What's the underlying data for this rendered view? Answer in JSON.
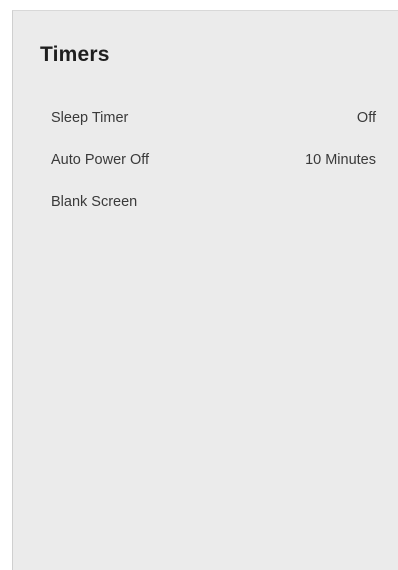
{
  "menu": {
    "title": "Timers",
    "items": [
      {
        "label": "Sleep Timer",
        "value": "Off"
      },
      {
        "label": "Auto Power Off",
        "value": "10 Minutes"
      },
      {
        "label": "Blank Screen",
        "value": ""
      }
    ]
  }
}
